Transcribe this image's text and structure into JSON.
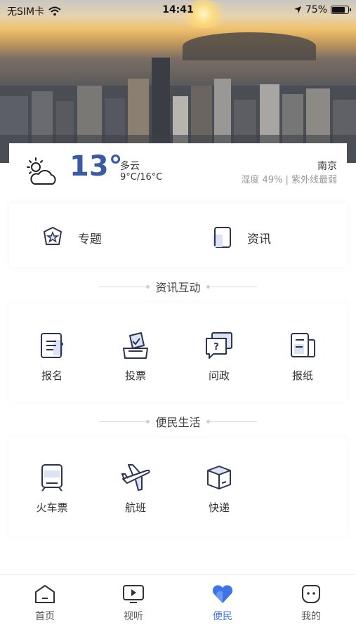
{
  "status_bar": {
    "carrier": "无SIM卡",
    "time": "14:41",
    "battery": "75%",
    "battery_level": 0.75
  },
  "weather": {
    "temperature": "13°",
    "condition": "多云",
    "range": "9°C/16°C",
    "city": "南京",
    "detail": "湿度 49% | 紫外线最弱",
    "icon": "cloudy-sun-icon"
  },
  "topics": [
    {
      "label": "专题",
      "icon": "shield-star-icon"
    },
    {
      "label": "资讯",
      "icon": "news-book-icon"
    }
  ],
  "sections": [
    {
      "title": "资讯互动",
      "items": [
        {
          "label": "报名",
          "icon": "signup-form-icon"
        },
        {
          "label": "投票",
          "icon": "ballot-box-icon"
        },
        {
          "label": "问政",
          "icon": "question-chat-icon"
        },
        {
          "label": "报纸",
          "icon": "newspaper-icon"
        }
      ]
    },
    {
      "title": "便民生活",
      "items": [
        {
          "label": "火车票",
          "icon": "train-icon"
        },
        {
          "label": "航班",
          "icon": "airplane-icon"
        },
        {
          "label": "快递",
          "icon": "package-box-icon"
        }
      ]
    }
  ],
  "tabbar": [
    {
      "label": "首页",
      "icon": "home-icon",
      "active": false
    },
    {
      "label": "视听",
      "icon": "video-play-icon",
      "active": false
    },
    {
      "label": "便民",
      "icon": "heart-icon",
      "active": true
    },
    {
      "label": "我的",
      "icon": "profile-face-icon",
      "active": false
    }
  ],
  "colors": {
    "accent": "#3f74e8",
    "temperature": "#3b5aa6",
    "icon_stroke": "#2b3452",
    "icon_fill": "#dbe3f5"
  }
}
